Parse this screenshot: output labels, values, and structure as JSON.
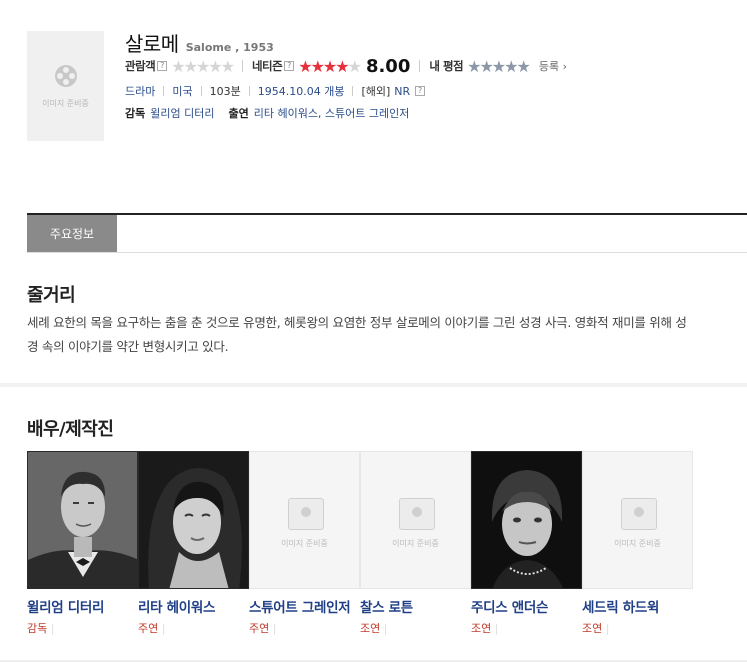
{
  "movie": {
    "title": "살로메",
    "original": "Salome , 1953",
    "poster_caption": "이미지 준비중"
  },
  "ratings": {
    "audience_label": "관람객",
    "audience_stars": 0,
    "netizen_label": "네티즌",
    "netizen_stars": 4,
    "netizen_score": "8.00",
    "my_label": "내 평점",
    "register_label": "등록 ›",
    "help": "?"
  },
  "info": {
    "genre": "드라마",
    "country": "미국",
    "runtime": "103분",
    "release": "1954.10.04 개봉",
    "rating_prefix": "[해외]",
    "rating": "NR",
    "director_label": "감독",
    "director": "윌리엄 디터리",
    "cast_label": "출연",
    "cast": "리타 헤이워스, 스튜어트 그레인저"
  },
  "tabs": [
    "주요정보"
  ],
  "synopsis": {
    "heading": "줄거리",
    "text": "세례 요한의 목을 요구하는 춤을 춘 것으로 유명한, 헤롯왕의 요염한 정부 살로메의 이야기를 그린 성경 사극. 영화적 재미를 위해 성경 속의 이야기를 약간 변형시키고 있다."
  },
  "cast_section": {
    "heading": "배우/제작진",
    "people": [
      {
        "name": "윌리엄 디터리",
        "role": "감독",
        "photo": "portrait"
      },
      {
        "name": "리타 헤이워스",
        "role": "주연",
        "photo": "portrait"
      },
      {
        "name": "스튜어트 그레인저",
        "role": "주연",
        "photo": "placeholder"
      },
      {
        "name": "찰스 로튼",
        "role": "조연",
        "photo": "placeholder"
      },
      {
        "name": "주디스 앤더슨",
        "role": "조연",
        "photo": "portrait"
      },
      {
        "name": "세드릭 하드윅",
        "role": "조연",
        "photo": "placeholder"
      }
    ],
    "placeholder_caption": "이미지 준비중"
  }
}
